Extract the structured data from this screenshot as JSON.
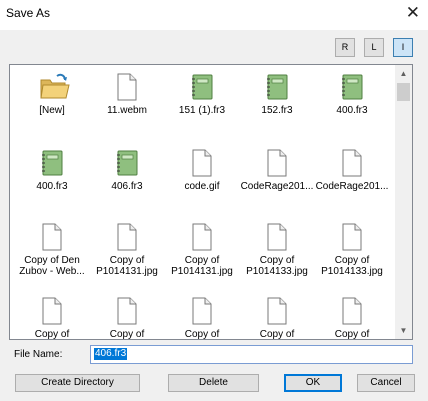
{
  "window": {
    "title": "Save As",
    "close_glyph": "✕"
  },
  "view_buttons": [
    {
      "label": "R",
      "active": false
    },
    {
      "label": "L",
      "active": false
    },
    {
      "label": "I",
      "active": true
    }
  ],
  "files": [
    {
      "label": "[New]",
      "icon": "folder-icon"
    },
    {
      "label": "11.webm",
      "icon": "document-icon"
    },
    {
      "label": "151 (1).fr3",
      "icon": "report-icon"
    },
    {
      "label": "152.fr3",
      "icon": "report-icon"
    },
    {
      "label": "400.fr3",
      "icon": "report-icon"
    },
    {
      "label": "400.fr3",
      "icon": "report-icon"
    },
    {
      "label": "406.fr3",
      "icon": "report-icon"
    },
    {
      "label": "code.gif",
      "icon": "document-icon"
    },
    {
      "label": "CodeRage201...",
      "icon": "document-icon"
    },
    {
      "label": "CodeRage201...",
      "icon": "document-icon"
    },
    {
      "label": "Copy of Den\nZubov - Web...",
      "icon": "document-icon"
    },
    {
      "label": "Copy of\nP1014131.jpg",
      "icon": "document-icon"
    },
    {
      "label": "Copy of\nP1014131.jpg",
      "icon": "document-icon"
    },
    {
      "label": "Copy of\nP1014133.jpg",
      "icon": "document-icon"
    },
    {
      "label": "Copy of\nP1014133.jpg",
      "icon": "document-icon"
    },
    {
      "label": "Copy of",
      "icon": "document-icon"
    },
    {
      "label": "Copy of",
      "icon": "document-icon"
    },
    {
      "label": "Copy of",
      "icon": "document-icon"
    },
    {
      "label": "Copy of",
      "icon": "document-icon"
    },
    {
      "label": "Copy of",
      "icon": "document-icon"
    }
  ],
  "scrollbar": {
    "up_glyph": "▲",
    "down_glyph": "▼"
  },
  "file_name": {
    "label": "File Name:",
    "value": "406.fr3"
  },
  "buttons": {
    "create_directory": "Create Directory",
    "delete": "Delete",
    "ok": "OK",
    "cancel": "Cancel"
  },
  "colors": {
    "selection": "#0078d7",
    "report_icon": "#8fbf7f"
  }
}
